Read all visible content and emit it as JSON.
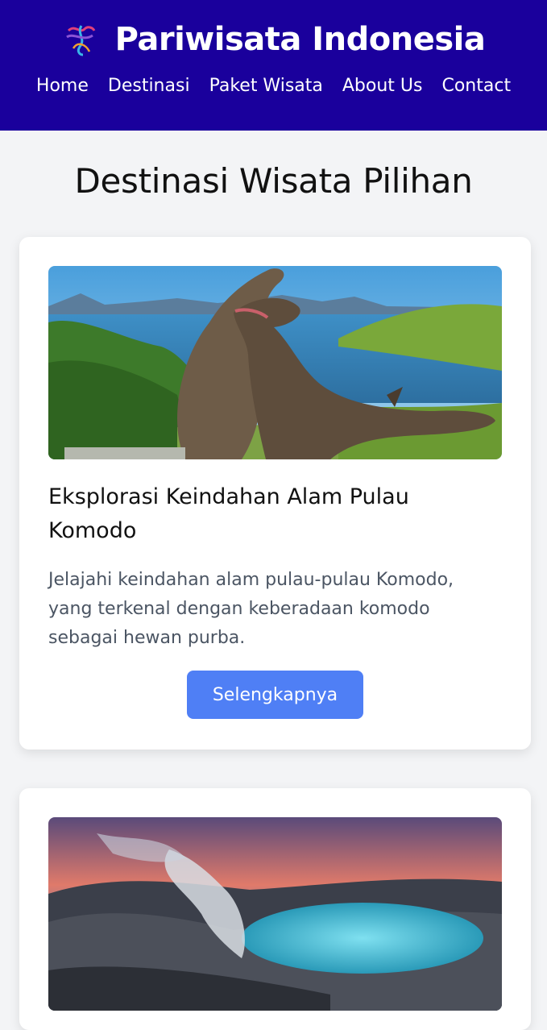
{
  "header": {
    "title": "Pariwisata Indonesia",
    "logo_icon": "ribbon-logo-icon",
    "nav": [
      "Home",
      "Destinasi",
      "Paket Wisata",
      "About Us",
      "Contact"
    ]
  },
  "main": {
    "title": "Destinasi Wisata Pilihan",
    "cards": [
      {
        "title": "Eksplorasi Keindahan Alam Pulau Komodo",
        "description": "Jelajahi keindahan alam pulau-pulau Komodo, yang terkenal dengan keberadaan komodo sebagai hewan purba.",
        "button": "Selengkapnya",
        "image": "komodo-island-photo"
      },
      {
        "image": "volcano-crater-lake-photo"
      }
    ]
  },
  "colors": {
    "header_bg": "#1a009c",
    "button_bg": "#4f7ff5",
    "page_bg": "#f3f4f6"
  }
}
